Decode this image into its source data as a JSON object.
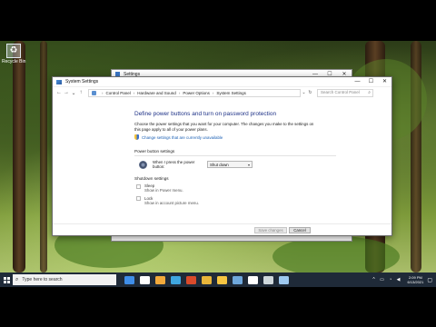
{
  "desktop": {
    "recycle_bin_label": "Recycle Bin"
  },
  "background_window": {
    "title": "Settings",
    "controls": [
      "—",
      "☐",
      "✕"
    ]
  },
  "window": {
    "title": "System Settings",
    "controls": [
      "—",
      "☐",
      "✕"
    ],
    "breadcrumb": [
      "Control Panel",
      "Hardware and Sound",
      "Power Options",
      "System Settings"
    ],
    "search_placeholder": "Search Control Panel"
  },
  "content": {
    "title": "Define power buttons and turn on password protection",
    "description": "Choose the power settings that you want for your computer. The changes you make to the settings on this page apply to all of your power plans.",
    "change_link": "Change settings that are currently unavailable",
    "power_section_label": "Power button settings",
    "power_row_label": "When I press the power button:",
    "power_select_value": "Shut down",
    "shutdown_section_label": "Shutdown settings",
    "options": [
      {
        "title": "Sleep",
        "subtitle": "Show in Power menu."
      },
      {
        "title": "Lock",
        "subtitle": "Show in account picture menu."
      }
    ]
  },
  "footer": {
    "save_label": "Save changes",
    "cancel_label": "Cancel"
  },
  "taskbar": {
    "search_placeholder": "Type here to search",
    "time": "2:09 PM",
    "date": "6/13/2021",
    "icon_colors": [
      "#3f8ee9",
      "#ffffff",
      "#f2a93b",
      "#3fa6e0",
      "#d94a2b",
      "#e8b53a",
      "#f5c542",
      "#6fa8dc",
      "#ffffff",
      "#cfd8dc",
      "#9ec9f0"
    ]
  }
}
